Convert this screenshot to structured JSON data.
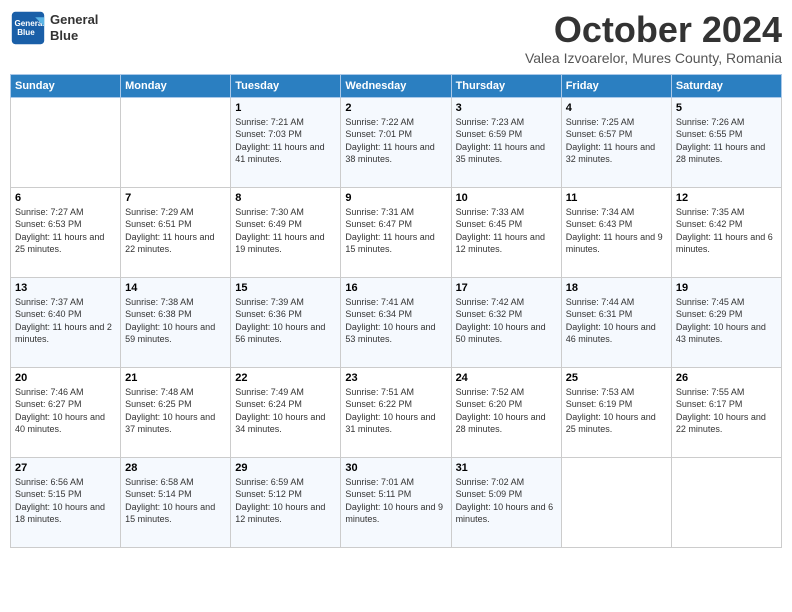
{
  "header": {
    "logo_line1": "General",
    "logo_line2": "Blue",
    "month": "October 2024",
    "location": "Valea Izvoarelor, Mures County, Romania"
  },
  "days_of_week": [
    "Sunday",
    "Monday",
    "Tuesday",
    "Wednesday",
    "Thursday",
    "Friday",
    "Saturday"
  ],
  "weeks": [
    [
      {
        "day": "",
        "content": ""
      },
      {
        "day": "",
        "content": ""
      },
      {
        "day": "1",
        "content": "Sunrise: 7:21 AM\nSunset: 7:03 PM\nDaylight: 11 hours and 41 minutes."
      },
      {
        "day": "2",
        "content": "Sunrise: 7:22 AM\nSunset: 7:01 PM\nDaylight: 11 hours and 38 minutes."
      },
      {
        "day": "3",
        "content": "Sunrise: 7:23 AM\nSunset: 6:59 PM\nDaylight: 11 hours and 35 minutes."
      },
      {
        "day": "4",
        "content": "Sunrise: 7:25 AM\nSunset: 6:57 PM\nDaylight: 11 hours and 32 minutes."
      },
      {
        "day": "5",
        "content": "Sunrise: 7:26 AM\nSunset: 6:55 PM\nDaylight: 11 hours and 28 minutes."
      }
    ],
    [
      {
        "day": "6",
        "content": "Sunrise: 7:27 AM\nSunset: 6:53 PM\nDaylight: 11 hours and 25 minutes."
      },
      {
        "day": "7",
        "content": "Sunrise: 7:29 AM\nSunset: 6:51 PM\nDaylight: 11 hours and 22 minutes."
      },
      {
        "day": "8",
        "content": "Sunrise: 7:30 AM\nSunset: 6:49 PM\nDaylight: 11 hours and 19 minutes."
      },
      {
        "day": "9",
        "content": "Sunrise: 7:31 AM\nSunset: 6:47 PM\nDaylight: 11 hours and 15 minutes."
      },
      {
        "day": "10",
        "content": "Sunrise: 7:33 AM\nSunset: 6:45 PM\nDaylight: 11 hours and 12 minutes."
      },
      {
        "day": "11",
        "content": "Sunrise: 7:34 AM\nSunset: 6:43 PM\nDaylight: 11 hours and 9 minutes."
      },
      {
        "day": "12",
        "content": "Sunrise: 7:35 AM\nSunset: 6:42 PM\nDaylight: 11 hours and 6 minutes."
      }
    ],
    [
      {
        "day": "13",
        "content": "Sunrise: 7:37 AM\nSunset: 6:40 PM\nDaylight: 11 hours and 2 minutes."
      },
      {
        "day": "14",
        "content": "Sunrise: 7:38 AM\nSunset: 6:38 PM\nDaylight: 10 hours and 59 minutes."
      },
      {
        "day": "15",
        "content": "Sunrise: 7:39 AM\nSunset: 6:36 PM\nDaylight: 10 hours and 56 minutes."
      },
      {
        "day": "16",
        "content": "Sunrise: 7:41 AM\nSunset: 6:34 PM\nDaylight: 10 hours and 53 minutes."
      },
      {
        "day": "17",
        "content": "Sunrise: 7:42 AM\nSunset: 6:32 PM\nDaylight: 10 hours and 50 minutes."
      },
      {
        "day": "18",
        "content": "Sunrise: 7:44 AM\nSunset: 6:31 PM\nDaylight: 10 hours and 46 minutes."
      },
      {
        "day": "19",
        "content": "Sunrise: 7:45 AM\nSunset: 6:29 PM\nDaylight: 10 hours and 43 minutes."
      }
    ],
    [
      {
        "day": "20",
        "content": "Sunrise: 7:46 AM\nSunset: 6:27 PM\nDaylight: 10 hours and 40 minutes."
      },
      {
        "day": "21",
        "content": "Sunrise: 7:48 AM\nSunset: 6:25 PM\nDaylight: 10 hours and 37 minutes."
      },
      {
        "day": "22",
        "content": "Sunrise: 7:49 AM\nSunset: 6:24 PM\nDaylight: 10 hours and 34 minutes."
      },
      {
        "day": "23",
        "content": "Sunrise: 7:51 AM\nSunset: 6:22 PM\nDaylight: 10 hours and 31 minutes."
      },
      {
        "day": "24",
        "content": "Sunrise: 7:52 AM\nSunset: 6:20 PM\nDaylight: 10 hours and 28 minutes."
      },
      {
        "day": "25",
        "content": "Sunrise: 7:53 AM\nSunset: 6:19 PM\nDaylight: 10 hours and 25 minutes."
      },
      {
        "day": "26",
        "content": "Sunrise: 7:55 AM\nSunset: 6:17 PM\nDaylight: 10 hours and 22 minutes."
      }
    ],
    [
      {
        "day": "27",
        "content": "Sunrise: 6:56 AM\nSunset: 5:15 PM\nDaylight: 10 hours and 18 minutes."
      },
      {
        "day": "28",
        "content": "Sunrise: 6:58 AM\nSunset: 5:14 PM\nDaylight: 10 hours and 15 minutes."
      },
      {
        "day": "29",
        "content": "Sunrise: 6:59 AM\nSunset: 5:12 PM\nDaylight: 10 hours and 12 minutes."
      },
      {
        "day": "30",
        "content": "Sunrise: 7:01 AM\nSunset: 5:11 PM\nDaylight: 10 hours and 9 minutes."
      },
      {
        "day": "31",
        "content": "Sunrise: 7:02 AM\nSunset: 5:09 PM\nDaylight: 10 hours and 6 minutes."
      },
      {
        "day": "",
        "content": ""
      },
      {
        "day": "",
        "content": ""
      }
    ]
  ]
}
